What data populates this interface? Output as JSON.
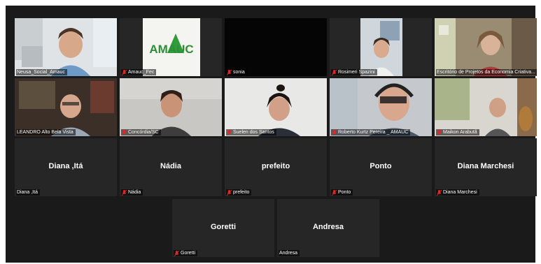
{
  "participants": [
    {
      "name": "Neusa_Social_Amauc",
      "muted": false,
      "video": true
    },
    {
      "name": "Amauc_Fec",
      "muted": true,
      "video": true,
      "logo_text": "AMAUC"
    },
    {
      "name": "sonia",
      "muted": true,
      "video": true
    },
    {
      "name": "Rosimeri Spazini",
      "muted": true,
      "video": true
    },
    {
      "name": "Escritório de Projetos da Economia Criativa...",
      "muted": false,
      "video": true,
      "active_speaker": true
    },
    {
      "name": "LEANDRO Alto Bela Vista",
      "muted": false,
      "video": true
    },
    {
      "name": "Concórdia/SC",
      "muted": true,
      "video": true
    },
    {
      "name": "Suelen dos Santos",
      "muted": true,
      "video": true
    },
    {
      "name": "Roberto Kurtz Pereira _ AMAUC",
      "muted": true,
      "video": true
    },
    {
      "name": "Maikon Arabutã",
      "muted": true,
      "video": true
    },
    {
      "name": "Diana ,Itá",
      "display": "Diana ,Itá",
      "muted": false,
      "video": false
    },
    {
      "name": "Nádia",
      "display": "Nádia",
      "muted": true,
      "video": false
    },
    {
      "name": "prefeito",
      "display": "prefeito",
      "muted": true,
      "video": false
    },
    {
      "name": "Ponto",
      "display": "Ponto",
      "muted": true,
      "video": false
    },
    {
      "name": "Diana Marchesi",
      "display": "Diana Marchesi",
      "muted": true,
      "video": false
    },
    {
      "name": "Goretti",
      "display": "Goretti",
      "muted": true,
      "video": false
    },
    {
      "name": "Andresa",
      "display": "Andresa",
      "muted": false,
      "video": false
    }
  ],
  "colors": {
    "muted_icon": "#e02828",
    "active_border": "#b8d94a",
    "background": "#1a1a1a"
  }
}
